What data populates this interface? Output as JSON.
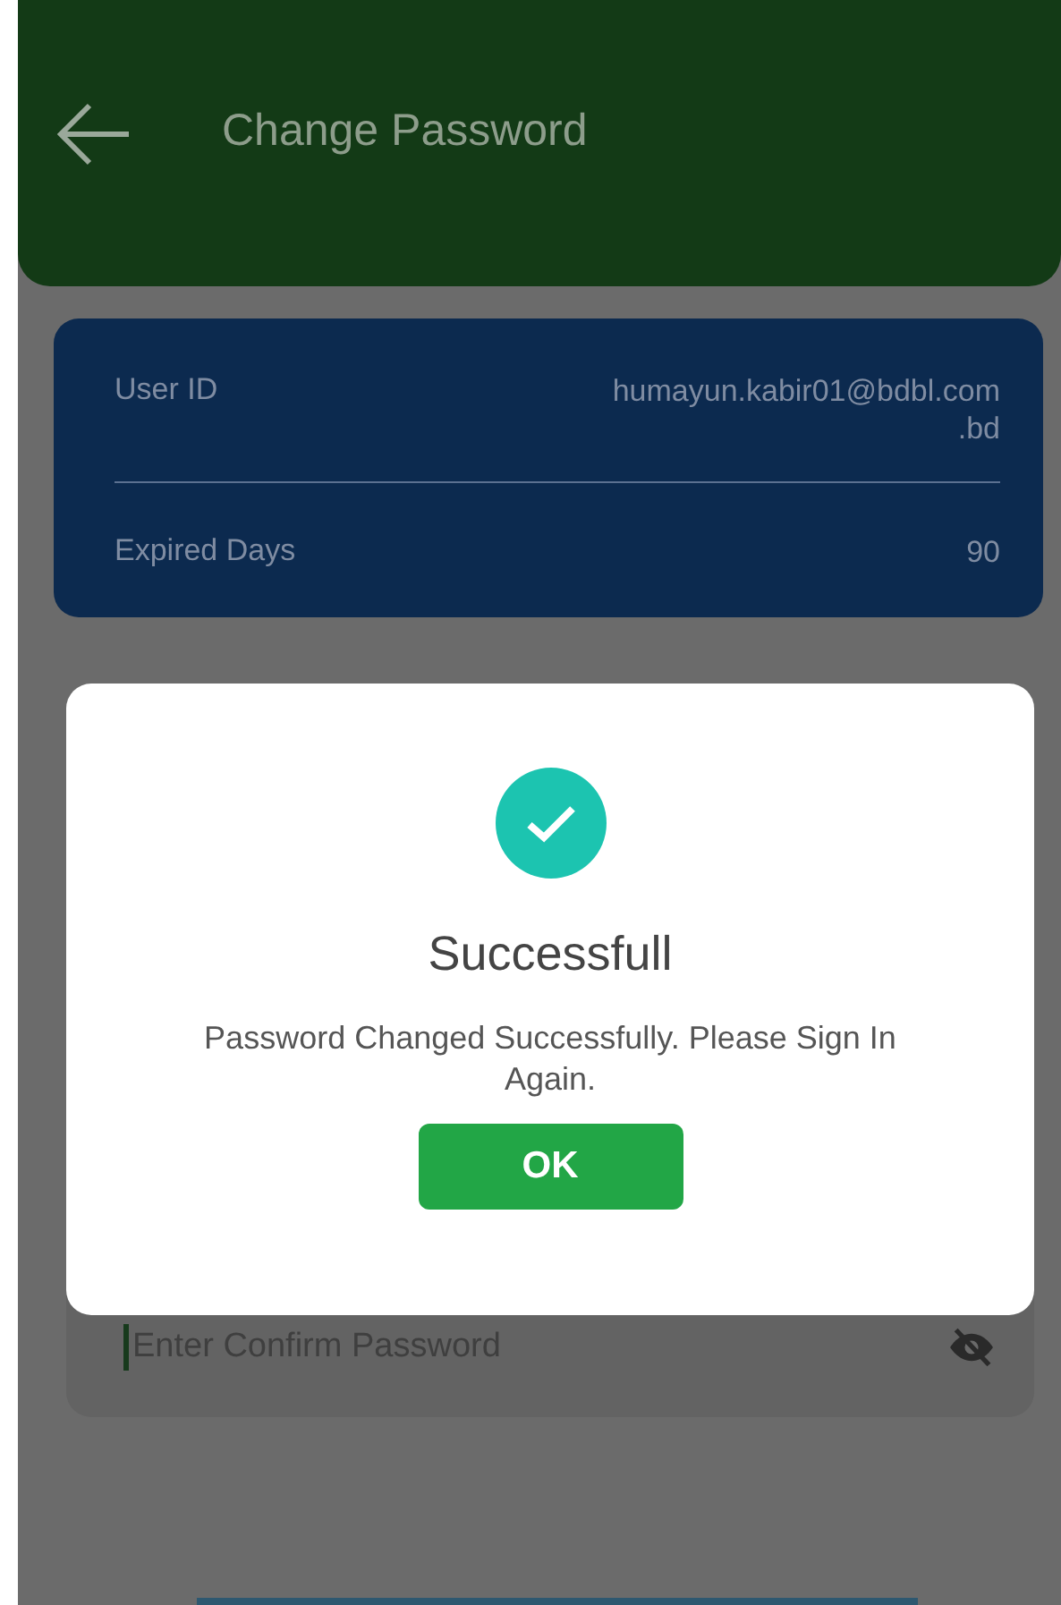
{
  "header": {
    "title": "Change Password"
  },
  "account": {
    "rows": [
      {
        "label": "User ID",
        "value": "humayun.kabir01@bdbl.com .bd"
      },
      {
        "label": "Expired Days",
        "value": "90"
      }
    ]
  },
  "confirm_field": {
    "placeholder": "Enter Confirm Password"
  },
  "dialog": {
    "title": "Successfull",
    "message": "Password Changed Successfully. Please Sign In Again.",
    "button": "OK"
  }
}
